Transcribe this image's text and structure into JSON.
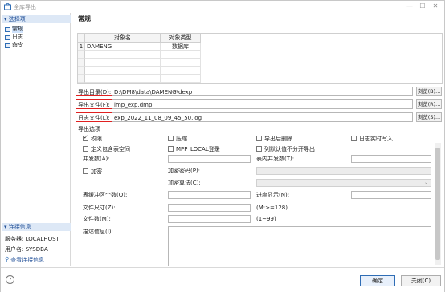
{
  "window": {
    "title": "全库导出"
  },
  "sidebar": {
    "section1_title": "选择项",
    "items": [
      {
        "label": "常规",
        "selected": true
      },
      {
        "label": "日志",
        "selected": false
      },
      {
        "label": "命令",
        "selected": false
      }
    ],
    "section2_title": "连接信息",
    "server_label": "服务器: LOCALHOST",
    "user_label": "用户名: SYSDBA",
    "view_link": "查看连接信息"
  },
  "main": {
    "title": "常规",
    "table": {
      "columns": [
        "对象名",
        "对象类型"
      ],
      "rows": [
        {
          "no": "1",
          "name": "DAMENG",
          "type": "数据库"
        }
      ]
    },
    "export_dir": {
      "label": "导出目录(D):",
      "value": "D:\\DM8\\data\\DAMENG\\dexp",
      "browse": "浏览(B)..."
    },
    "export_file": {
      "label": "导出文件(F):",
      "value": "imp_exp.dmp",
      "browse": "浏览(R)..."
    },
    "log_file": {
      "label": "日志文件(L):",
      "value": "exp_2022_11_08_09_45_50.log",
      "browse": "浏览(S)..."
    },
    "options": {
      "title": "导出选项",
      "row1": [
        {
          "label": "权限",
          "checked": true
        },
        {
          "label": "压缩",
          "checked": false
        },
        {
          "label": "导出后删除",
          "checked": false
        },
        {
          "label": "日志实时写入",
          "checked": false
        }
      ],
      "row2": [
        {
          "label": "定义包含表空间",
          "checked": false
        },
        {
          "label": "MPP_LOCAL登录",
          "checked": false
        },
        {
          "label": "列默认值不分开导出",
          "checked": false
        }
      ],
      "parallel_label": "并发数(A):",
      "table_parallel_label": "表内并发数(T):",
      "encrypt_label": "加密",
      "encrypt_pwd_label": "加密密码(P):",
      "encrypt_algo_label": "加密算法(C):",
      "table_buffer_label": "表缓冲区个数(O):",
      "progress_label": "进度显示(N):",
      "file_size_label": "文件尺寸(Z):",
      "file_size_hint": "(M:>=128)",
      "file_count_label": "文件数(M):",
      "file_count_hint": "(1~99)",
      "desc_label": "描述信息(I):"
    }
  },
  "footer": {
    "help": "?",
    "ok": "确定",
    "close": "关闭(C)"
  }
}
